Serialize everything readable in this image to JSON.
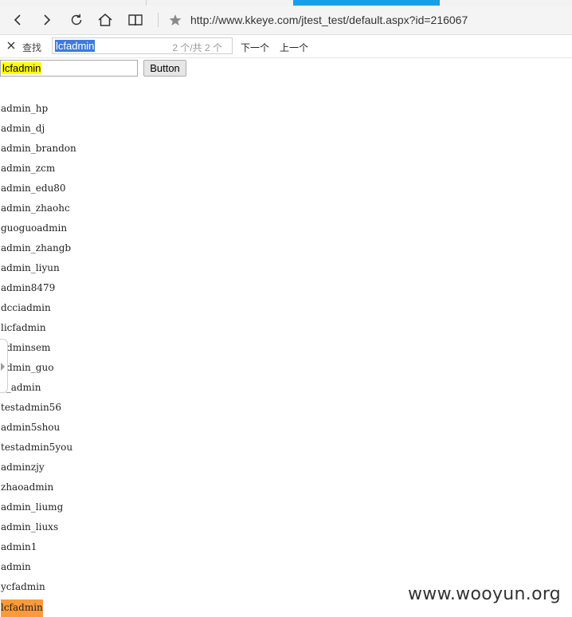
{
  "browser": {
    "url": "http://www.kkeye.com/jtest_test/default.aspx?id=216067",
    "icons": {
      "back": "back-arrow-icon",
      "forward": "forward-arrow-icon",
      "refresh": "refresh-icon",
      "home": "home-icon",
      "reading": "book-icon",
      "favorite": "star-icon"
    },
    "accent_color": "#1a9fe6"
  },
  "find_bar": {
    "label": "查找",
    "query": "lcfadmin",
    "count": "2 个/共 2 个",
    "next_label": "下一个",
    "prev_label": "上一个"
  },
  "page": {
    "input_value": "lcfadmin",
    "button_label": "Button",
    "results": [
      "admin_hp",
      "admin_dj",
      "admin_brandon",
      "admin_zcm",
      "admin_edu80",
      "admin_zhaohc",
      "guoguoadmin",
      "admin_zhangb",
      "admin_liyun",
      "admin8479",
      "dcciadmin",
      "licfadmin",
      "adminsem",
      "admin_guo",
      "c_admin",
      "testadmin56",
      "admin5shou",
      "testadmin5you",
      "adminzjy",
      "zhaoadmin",
      "admin_liumg",
      "admin_liuxs",
      "admin1",
      "admin",
      "ycfadmin",
      "lcfadmin"
    ],
    "highlight_color": "#ff9a3a"
  },
  "watermark": "www.wooyun.org"
}
